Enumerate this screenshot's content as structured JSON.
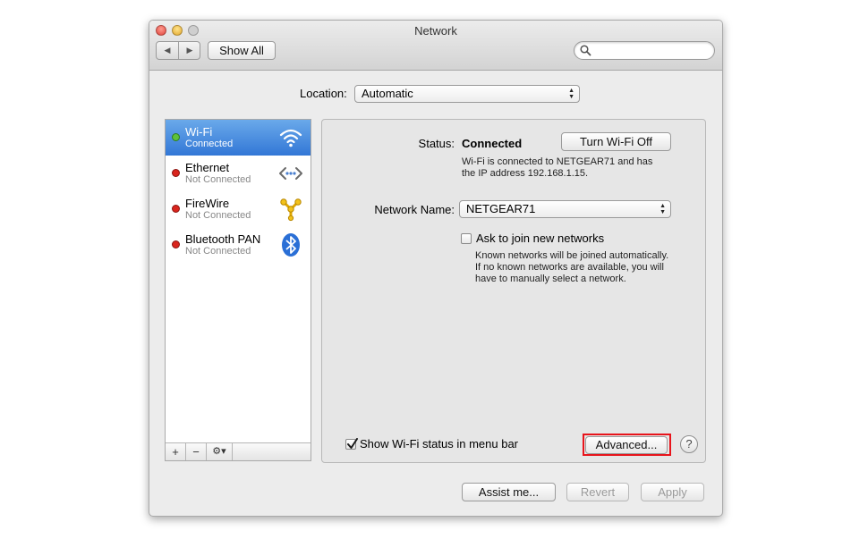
{
  "window": {
    "title": "Network"
  },
  "toolbar": {
    "back_glyph": "◀",
    "forward_glyph": "▶",
    "show_all_label": "Show All",
    "search_placeholder": ""
  },
  "location": {
    "label": "Location:",
    "value": "Automatic"
  },
  "services": [
    {
      "name": "Wi-Fi",
      "status": "Connected",
      "status_color": "#5ec13a",
      "icon": "wifi-icon"
    },
    {
      "name": "Ethernet",
      "status": "Not Connected",
      "status_color": "#d9251d",
      "icon": "ethernet-icon"
    },
    {
      "name": "FireWire",
      "status": "Not Connected",
      "status_color": "#d9251d",
      "icon": "firewire-icon"
    },
    {
      "name": "Bluetooth PAN",
      "status": "Not Connected",
      "status_color": "#d9251d",
      "icon": "bluetooth-icon"
    }
  ],
  "sidebar_footer": {
    "add": "+",
    "remove": "−",
    "gear": "⚙▾"
  },
  "detail": {
    "status_label": "Status:",
    "status_value": "Connected",
    "toggle_button": "Turn Wi-Fi Off",
    "status_desc_1": "Wi-Fi is connected to NETGEAR71 and has",
    "status_desc_2": "the IP address 192.168.1.15.",
    "network_name_label": "Network Name:",
    "network_name_value": "NETGEAR71",
    "ask_join_label": "Ask to join new networks",
    "ask_join_checked": false,
    "ask_desc_1": "Known networks will be joined automatically.",
    "ask_desc_2": "If no known networks are available, you will",
    "ask_desc_3": "have to manually select a network.",
    "show_status_label": "Show Wi-Fi status in menu bar",
    "show_status_checked": true,
    "advanced_button": "Advanced...",
    "help_button": "?"
  },
  "footer": {
    "assist": "Assist me...",
    "revert": "Revert",
    "apply": "Apply"
  },
  "colors": {
    "selection": "#3277d6",
    "highlight_box": "#e8141b"
  }
}
